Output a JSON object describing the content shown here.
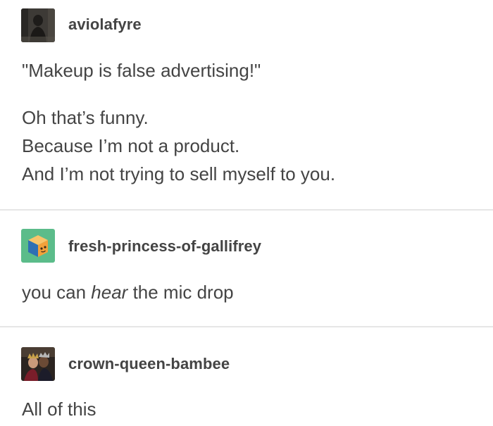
{
  "posts": [
    {
      "username": "aviolafyre",
      "avatar": "dark-photo-avatar",
      "quote": "\"Makeup is false advertising!\"",
      "lines": [
        "Oh that’s funny.",
        "Because I’m not a product.",
        "And I’m not trying to sell myself to you."
      ]
    },
    {
      "username": "fresh-princess-of-gallifrey",
      "avatar": "cube-avatar",
      "text_before": "you can ",
      "text_emphasis": "hear",
      "text_after": " the mic drop"
    },
    {
      "username": "crown-queen-bambee",
      "avatar": "crowned-couple-avatar",
      "text": "All of this"
    }
  ],
  "colors": {
    "text": "#444444",
    "divider": "#e6e6e6",
    "cube_bg": "#5bbc8a",
    "cube_blue": "#2f6fb3",
    "cube_orange": "#f2a13a"
  }
}
